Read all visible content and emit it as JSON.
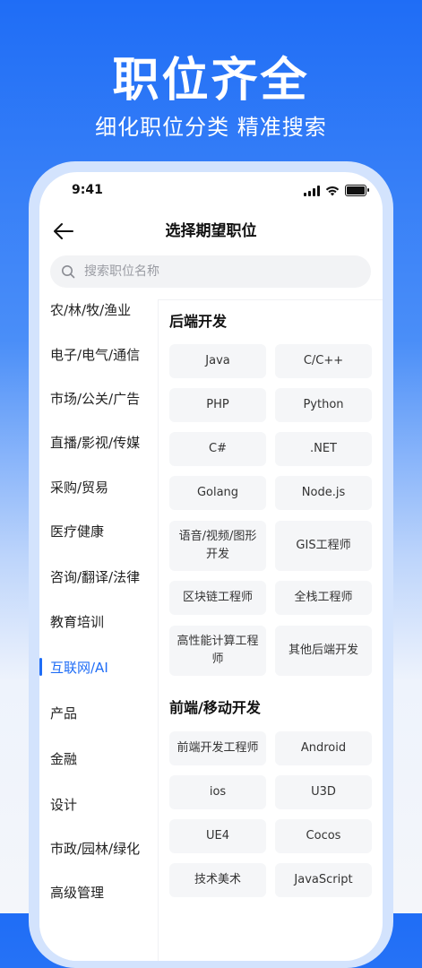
{
  "hero": {
    "title": "职位齐全",
    "subtitle": "细化职位分类 精准搜索"
  },
  "status_bar": {
    "time": "9:41",
    "icons": [
      "signal-icon",
      "wifi-icon",
      "battery-icon"
    ]
  },
  "nav": {
    "back_icon": "back-arrow-icon",
    "title": "选择期望职位"
  },
  "search": {
    "icon": "search-icon",
    "placeholder": "搜索职位名称"
  },
  "sidebar": {
    "items": [
      {
        "label": "农/林/牧/渔业",
        "active": false
      },
      {
        "label": "电子/电气/通信",
        "active": false
      },
      {
        "label": "市场/公关/广告",
        "active": false
      },
      {
        "label": "直播/影视/传媒",
        "active": false
      },
      {
        "label": "采购/贸易",
        "active": false
      },
      {
        "label": "医疗健康",
        "active": false
      },
      {
        "label": "咨询/翻译/法律",
        "active": false
      },
      {
        "label": "教育培训",
        "active": false
      },
      {
        "label": "互联网/AI",
        "active": true
      },
      {
        "label": "产品",
        "active": false
      },
      {
        "label": "金融",
        "active": false
      },
      {
        "label": "设计",
        "active": false
      },
      {
        "label": "市政/园林/绿化",
        "active": false
      },
      {
        "label": "高级管理",
        "active": false
      }
    ]
  },
  "sections": [
    {
      "title": "后端开发",
      "tags": [
        "Java",
        "C/C++",
        "PHP",
        "Python",
        "C#",
        ".NET",
        "Golang",
        "Node.js",
        "语音/视频/图形开发",
        "GIS工程师",
        "区块链工程师",
        "全栈工程师",
        "高性能计算工程师",
        "其他后端开发"
      ]
    },
    {
      "title": "前端/移动开发",
      "tags": [
        "前端开发工程师",
        "Android",
        "ios",
        "U3D",
        "UE4",
        "Cocos",
        "技术美术",
        "JavaScript"
      ]
    }
  ],
  "colors": {
    "accent": "#1f6df6",
    "tag_bg": "#f5f6f8",
    "search_bg": "#f2f3f5"
  }
}
